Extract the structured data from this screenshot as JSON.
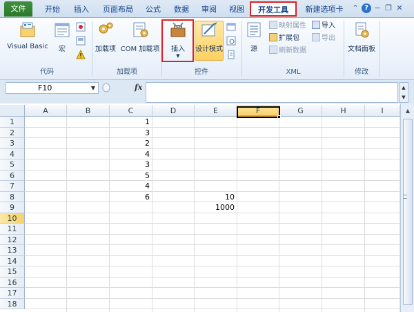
{
  "tabs": {
    "file": "文件",
    "home": "开始",
    "insert": "插入",
    "page_layout": "页面布局",
    "formulas": "公式",
    "data": "数据",
    "review": "审阅",
    "view": "视图",
    "developer": "开发工具",
    "new_tab": "新建选项卡"
  },
  "ribbon": {
    "code": {
      "label": "代码",
      "visual_basic": "Visual Basic",
      "macro": "宏"
    },
    "addins": {
      "label": "加载项",
      "addins": "加载项",
      "com_addins": "COM 加载项"
    },
    "controls": {
      "label": "控件",
      "insert": "插入",
      "design_mode": "设计模式"
    },
    "xml": {
      "label": "XML",
      "source": "源",
      "map_properties": "映射属性",
      "expansion_packs": "扩展包",
      "refresh_data": "刷新数据",
      "import": "导入",
      "export": "导出"
    },
    "modify": {
      "label": "修改",
      "document_panel": "文档面板"
    }
  },
  "formula_bar": {
    "name_box": "F10",
    "fx": "fx",
    "value": ""
  },
  "sheet": {
    "columns": [
      "A",
      "B",
      "C",
      "D",
      "E",
      "F",
      "G",
      "H",
      "I"
    ],
    "rows": [
      "1",
      "2",
      "3",
      "4",
      "5",
      "6",
      "7",
      "8",
      "9",
      "10",
      "11",
      "12",
      "13",
      "14",
      "15",
      "16",
      "17",
      "18"
    ],
    "selected_column": "F",
    "selected_row": "10",
    "cells": {
      "C1": "1",
      "C2": "3",
      "C3": "2",
      "C4": "4",
      "C5": "3",
      "C6": "5",
      "C7": "4",
      "C8": "6",
      "E8": "10",
      "E9": "1000"
    }
  },
  "colors": {
    "highlight_red": "#e02020",
    "file_tab_green": "#2a7a2a",
    "selected_header": "#f9d06b"
  }
}
